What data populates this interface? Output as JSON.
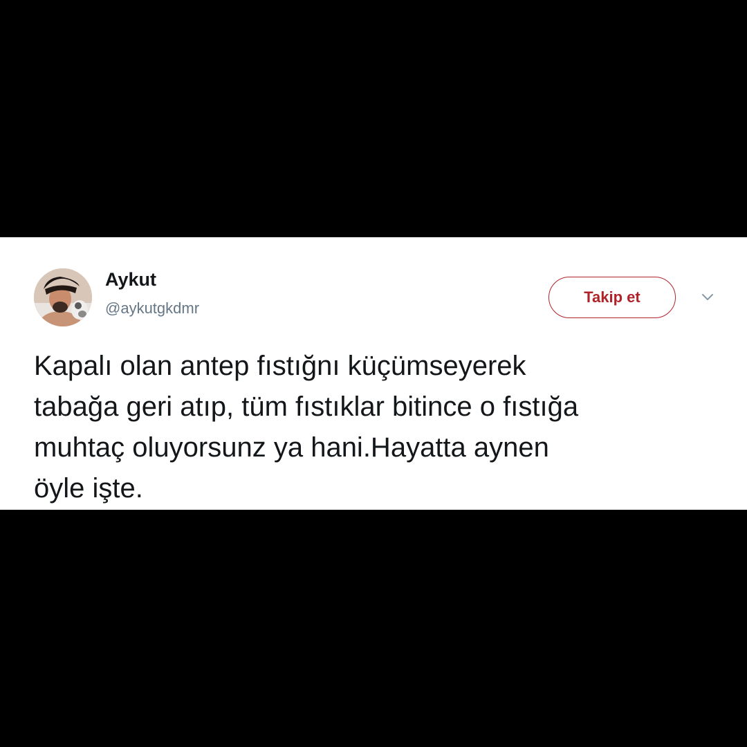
{
  "tweet": {
    "display_name": "Aykut",
    "handle": "@aykutgkdmr",
    "follow_label": "Takip et",
    "text": "Kapalı olan antep fıstığnı küçümseyerek\ntabağa geri atıp, tüm fıstıklar bitince o fıstığa\nmuhtaç oluyorsunz ya hani.Hayatta aynen\nöyle işte."
  },
  "icons": {
    "avatar": "profile-photo",
    "menu": "chevron-down-icon"
  },
  "colors": {
    "background": "#000000",
    "card": "#ffffff",
    "follow_accent": "#b1232a",
    "text_primary": "#14171a",
    "text_secondary": "#657786"
  }
}
